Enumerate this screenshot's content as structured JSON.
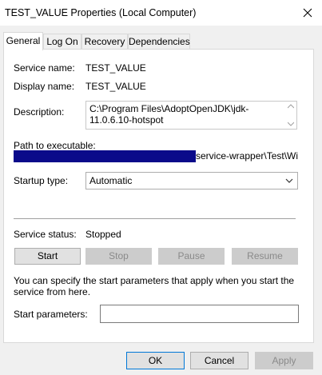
{
  "window": {
    "title": "TEST_VALUE Properties (Local Computer)",
    "close_icon": "close-icon"
  },
  "tabs": [
    {
      "label": "General",
      "active": true
    },
    {
      "label": "Log On",
      "active": false
    },
    {
      "label": "Recovery",
      "active": false
    },
    {
      "label": "Dependencies",
      "active": false
    }
  ],
  "general": {
    "service_name_label": "Service name:",
    "service_name_value": "TEST_VALUE",
    "display_name_label": "Display name:",
    "display_name_value": "TEST_VALUE",
    "description_label": "Description:",
    "description_value": "C:\\Program Files\\AdoptOpenJDK\\jdk-11.0.6.10-hotspot",
    "path_label": "Path to executable:",
    "path_visible_tail": "service-wrapper\\Test\\Win",
    "startup_type_label": "Startup type:",
    "startup_type_value": "Automatic",
    "service_status_label": "Service status:",
    "service_status_value": "Stopped",
    "buttons": {
      "start": "Start",
      "stop": "Stop",
      "pause": "Pause",
      "resume": "Resume"
    },
    "info_text": "You can specify the start parameters that apply when you start the service from here.",
    "start_params_label": "Start parameters:",
    "start_params_value": ""
  },
  "footer": {
    "ok": "OK",
    "cancel": "Cancel",
    "apply": "Apply"
  },
  "colors": {
    "path_highlight": "#0a0a8a",
    "focus_border": "#0078d7"
  }
}
